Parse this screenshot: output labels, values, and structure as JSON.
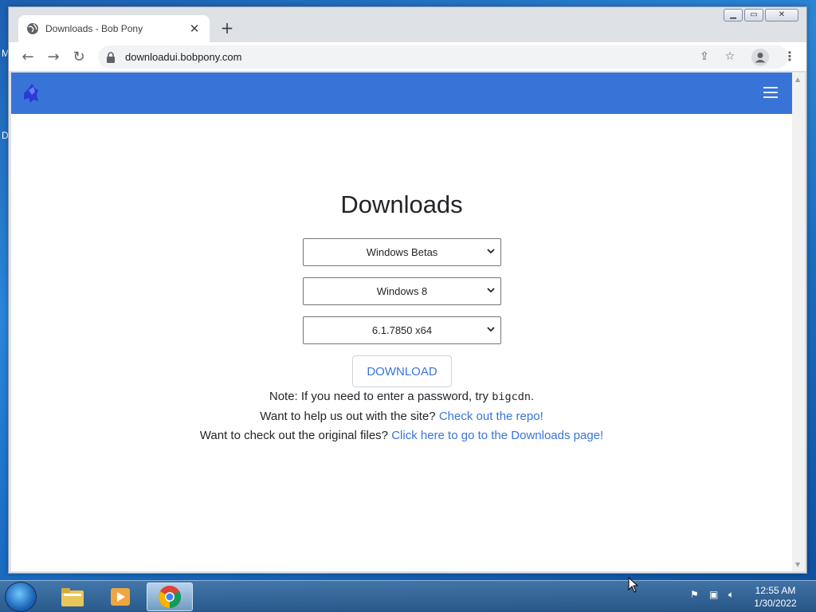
{
  "desktop": {
    "fragment_top": "M",
    "fragment_mid": "D"
  },
  "browser": {
    "tab": {
      "title": "Downloads - Bob Pony",
      "close_icon": "close-icon"
    },
    "new_tab_label": "+",
    "window_controls": {
      "minimize": "▁",
      "maximize": "▭",
      "close": "✕"
    },
    "url": "downloadui.bobpony.com"
  },
  "page": {
    "heading": "Downloads",
    "selects": {
      "category": "Windows Betas",
      "product": "Windows 8",
      "build": "6.1.7850 x64"
    },
    "download_button": "DOWNLOAD",
    "note_prefix": "Note: If you need to enter a password, try",
    "note_code": "bigcdn",
    "note_suffix": ".",
    "help_prefix": "Want to help us out with the site?",
    "help_link": "Check out the repo!",
    "files_prefix": "Want to check out the original files?",
    "files_link": "Click here to go to the Downloads page!"
  },
  "colors": {
    "accent": "#3874d8",
    "navbar": "#3874d8"
  },
  "taskbar": {
    "clock_time": "12:55 AM",
    "clock_date": "1/30/2022"
  }
}
